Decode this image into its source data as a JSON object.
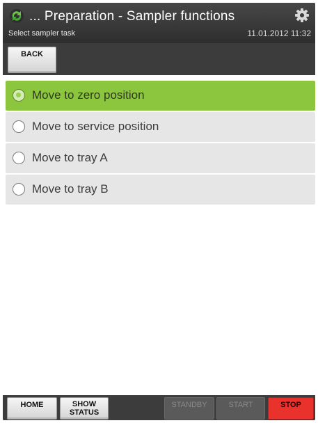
{
  "header": {
    "title": "... Preparation - Sampler functions",
    "subtitle": "Select sampler task",
    "timestamp": "11.01.2012 11:32",
    "app_icon": "recycle-arrows-icon",
    "settings_icon": "gear-icon"
  },
  "toolbar": {
    "back_label": "BACK"
  },
  "tasks": [
    {
      "label": "Move to zero position",
      "selected": true
    },
    {
      "label": "Move to service position",
      "selected": false
    },
    {
      "label": "Move to tray A",
      "selected": false
    },
    {
      "label": "Move to tray B",
      "selected": false
    }
  ],
  "footer": {
    "home_label": "HOME",
    "show_status_line1": "SHOW",
    "show_status_line2": "STATUS",
    "standby_label": "STANDBY",
    "start_label": "START",
    "stop_label": "STOP"
  },
  "colors": {
    "selected": "#8cc63f",
    "stop": "#e8322b",
    "item": "#e6e6e6",
    "bar": "#3c3c3c"
  }
}
